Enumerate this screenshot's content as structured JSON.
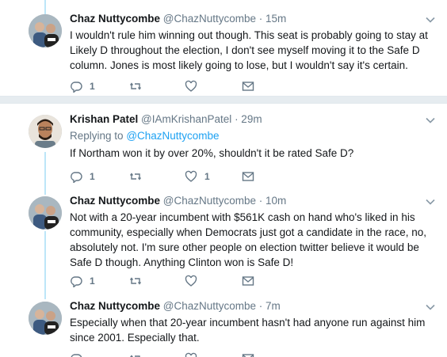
{
  "tweets": [
    {
      "name": "Chaz Nuttycombe",
      "handle": "@ChazNuttycombe",
      "time": "· 15m",
      "replying_prefix": "",
      "replying_to": "",
      "text": "I wouldn't rule him winning out though. This seat is probably going to stay at Likely D throughout the election, I don't see myself moving it to the Safe D column. Jones is most likely going to lose, but I wouldn't say it's certain.",
      "reply_count": "1",
      "retweet_count": "",
      "like_count": ""
    },
    {
      "name": "Krishan Patel",
      "handle": "@IAmKrishanPatel",
      "time": "· 29m",
      "replying_prefix": "Replying to",
      "replying_to": "@ChazNuttycombe",
      "text": "If Northam won it by over 20%, shouldn't it be rated Safe D?",
      "reply_count": "1",
      "retweet_count": "",
      "like_count": "1"
    },
    {
      "name": "Chaz Nuttycombe",
      "handle": "@ChazNuttycombe",
      "time": "· 10m",
      "replying_prefix": "",
      "replying_to": "",
      "text": "Not with a 20-year incumbent with $561K cash on hand who's liked in his community, especially when Democrats just got a candidate in the race, no, absolutely not. I'm sure other people on election twitter believe it would be Safe D though. Anything Clinton won is Safe D!",
      "reply_count": "1",
      "retweet_count": "",
      "like_count": ""
    },
    {
      "name": "Chaz Nuttycombe",
      "handle": "@ChazNuttycombe",
      "time": "· 7m",
      "replying_prefix": "",
      "replying_to": "",
      "text": "Especially when that 20-year incumbent hasn't had anyone run against him since 2001. Especially that.",
      "reply_count": "",
      "retweet_count": "",
      "like_count": ""
    }
  ],
  "icons": {
    "reply": "reply-icon",
    "retweet": "retweet-icon",
    "like": "heart-icon",
    "dm": "envelope-icon",
    "more": "chevron-down-icon"
  },
  "colors": {
    "link": "#1da1f2",
    "secondary_text": "#657786",
    "thread_line": "#bde6f8",
    "separator": "#e6ecf0"
  }
}
